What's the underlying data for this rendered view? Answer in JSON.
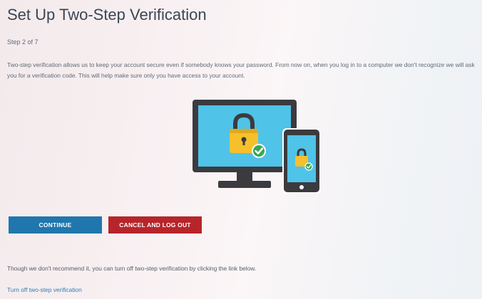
{
  "page": {
    "title": "Set Up Two-Step Verification",
    "step": "Step 2 of 7",
    "description": "Two-step verification allows us to keep your account secure even if somebody knows your password. From now on, when you log in to a computer we don't recognize we will ask you for a verification code. This will help make sure only you have access to your account."
  },
  "illustration": {
    "icons": [
      "monitor-icon",
      "padlock-icon",
      "checkmark-icon",
      "smartphone-icon"
    ]
  },
  "actions": {
    "continue_label": "CONTINUE",
    "cancel_label": "CANCEL AND LOG OUT"
  },
  "footer": {
    "note": "Though we don't recommend it, you can turn off two-step verification by clicking the link below.",
    "link": "Turn off two-step verification"
  },
  "colors": {
    "continue": "#1f77ad",
    "cancel": "#b7252b",
    "link": "#2f7fb5",
    "screen": "#4fc3e8",
    "lock": "#f5c02c",
    "check": "#3aa655",
    "device": "#3b3b3f"
  }
}
